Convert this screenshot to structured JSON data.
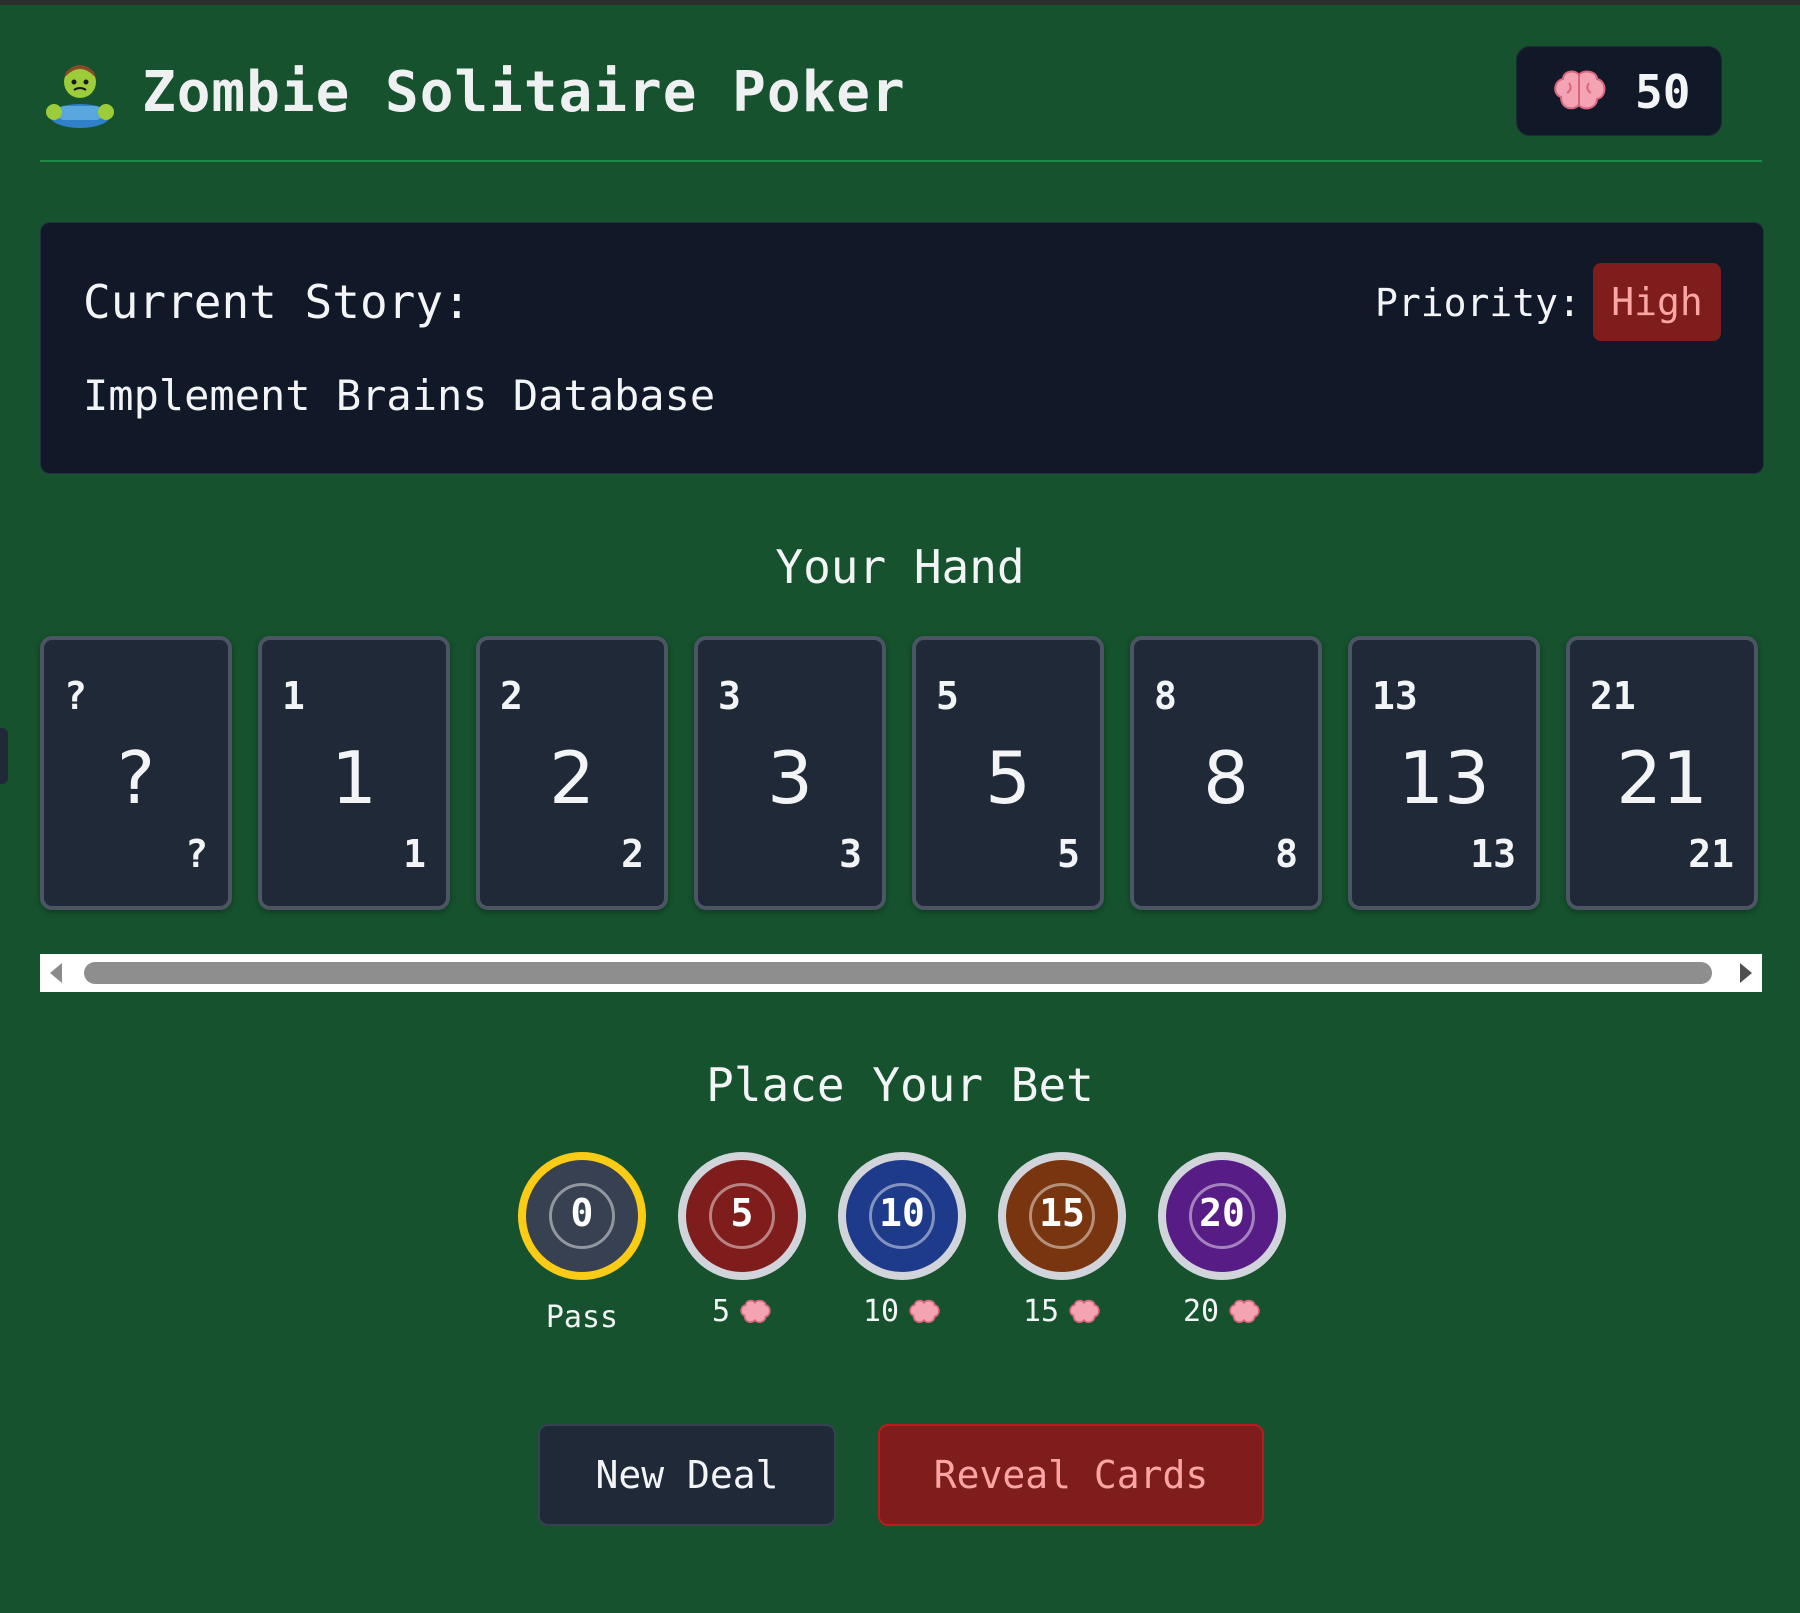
{
  "header": {
    "title": "Zombie Solitaire Poker",
    "logo_icon": "zombie-icon",
    "brains_icon": "brain-icon",
    "brains_count": "50"
  },
  "story": {
    "label": "Current Story:",
    "name": "Implement Brains Database",
    "priority_label": "Priority:",
    "priority_value": "High"
  },
  "hand": {
    "title": "Your Hand",
    "cards": [
      {
        "value": "?"
      },
      {
        "value": "1"
      },
      {
        "value": "2"
      },
      {
        "value": "3"
      },
      {
        "value": "5"
      },
      {
        "value": "8"
      },
      {
        "value": "13"
      },
      {
        "value": "21"
      }
    ]
  },
  "bet": {
    "title": "Place Your Bet",
    "chips": [
      {
        "value": "0",
        "label": "Pass",
        "color": "#374151",
        "selected": true
      },
      {
        "value": "5",
        "label": "5",
        "color": "#7f1d1d",
        "selected": false
      },
      {
        "value": "10",
        "label": "10",
        "color": "#1e3a8a",
        "selected": false
      },
      {
        "value": "15",
        "label": "15",
        "color": "#78350f",
        "selected": false
      },
      {
        "value": "20",
        "label": "20",
        "color": "#581c87",
        "selected": false
      }
    ]
  },
  "actions": {
    "new_deal": "New Deal",
    "reveal": "Reveal Cards"
  },
  "colors": {
    "background": "#15522d",
    "panel": "#111827",
    "card": "#1f2937",
    "accent_red": "#7f1d1d",
    "selected_ring": "#facc15"
  }
}
